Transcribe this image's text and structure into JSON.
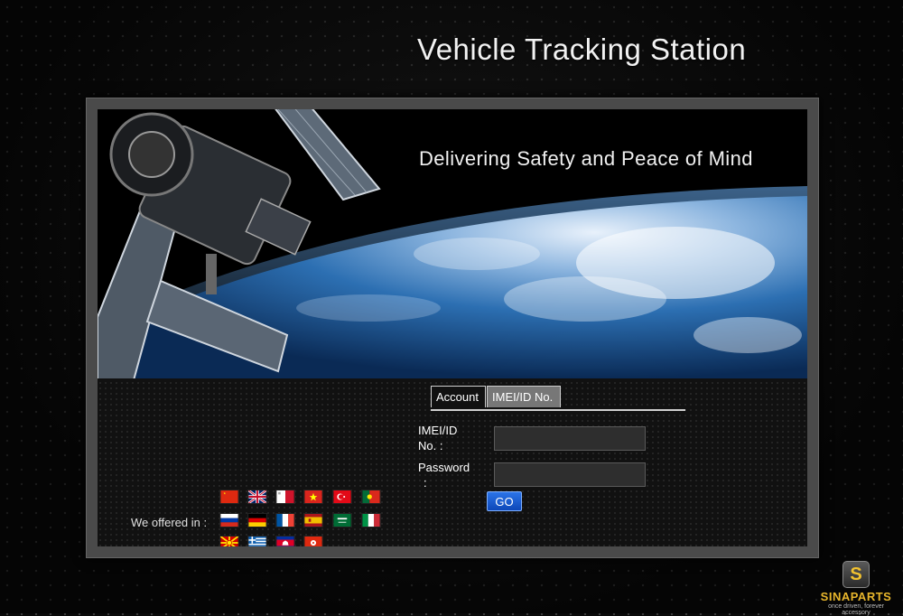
{
  "header": {
    "title": "Vehicle Tracking Station"
  },
  "hero": {
    "tagline": "Delivering Safety and Peace of Mind"
  },
  "tabs": [
    {
      "label": "Account",
      "active": true
    },
    {
      "label": "IMEI/ID No.",
      "active": false
    }
  ],
  "form": {
    "imei_label_line1": "IMEI/ID",
    "imei_label_line2": "No. :",
    "imei_value": "",
    "password_label_line1": "Password",
    "password_label_line2": ":",
    "password_value": "",
    "submit_label": "GO"
  },
  "languages": {
    "label": "We offered in :",
    "flags": [
      "china-flag",
      "uk-flag",
      "malta-flag",
      "vietnam-flag",
      "turkey-flag",
      "portugal-flag",
      "russia-flag",
      "germany-flag",
      "france-flag",
      "spain-flag",
      "saudi-arabia-flag",
      "italy-flag",
      "macedonia-flag",
      "greece-flag",
      "cambodia-flag",
      "hong-kong-flag"
    ]
  },
  "branding": {
    "logo_letter": "S",
    "name": "SINAPARTS",
    "slogan": "once driven, forever accessory"
  },
  "colors": {
    "accent": "#1e5fd8",
    "background": "#0a0a0a",
    "logo": "#e8b62c"
  }
}
